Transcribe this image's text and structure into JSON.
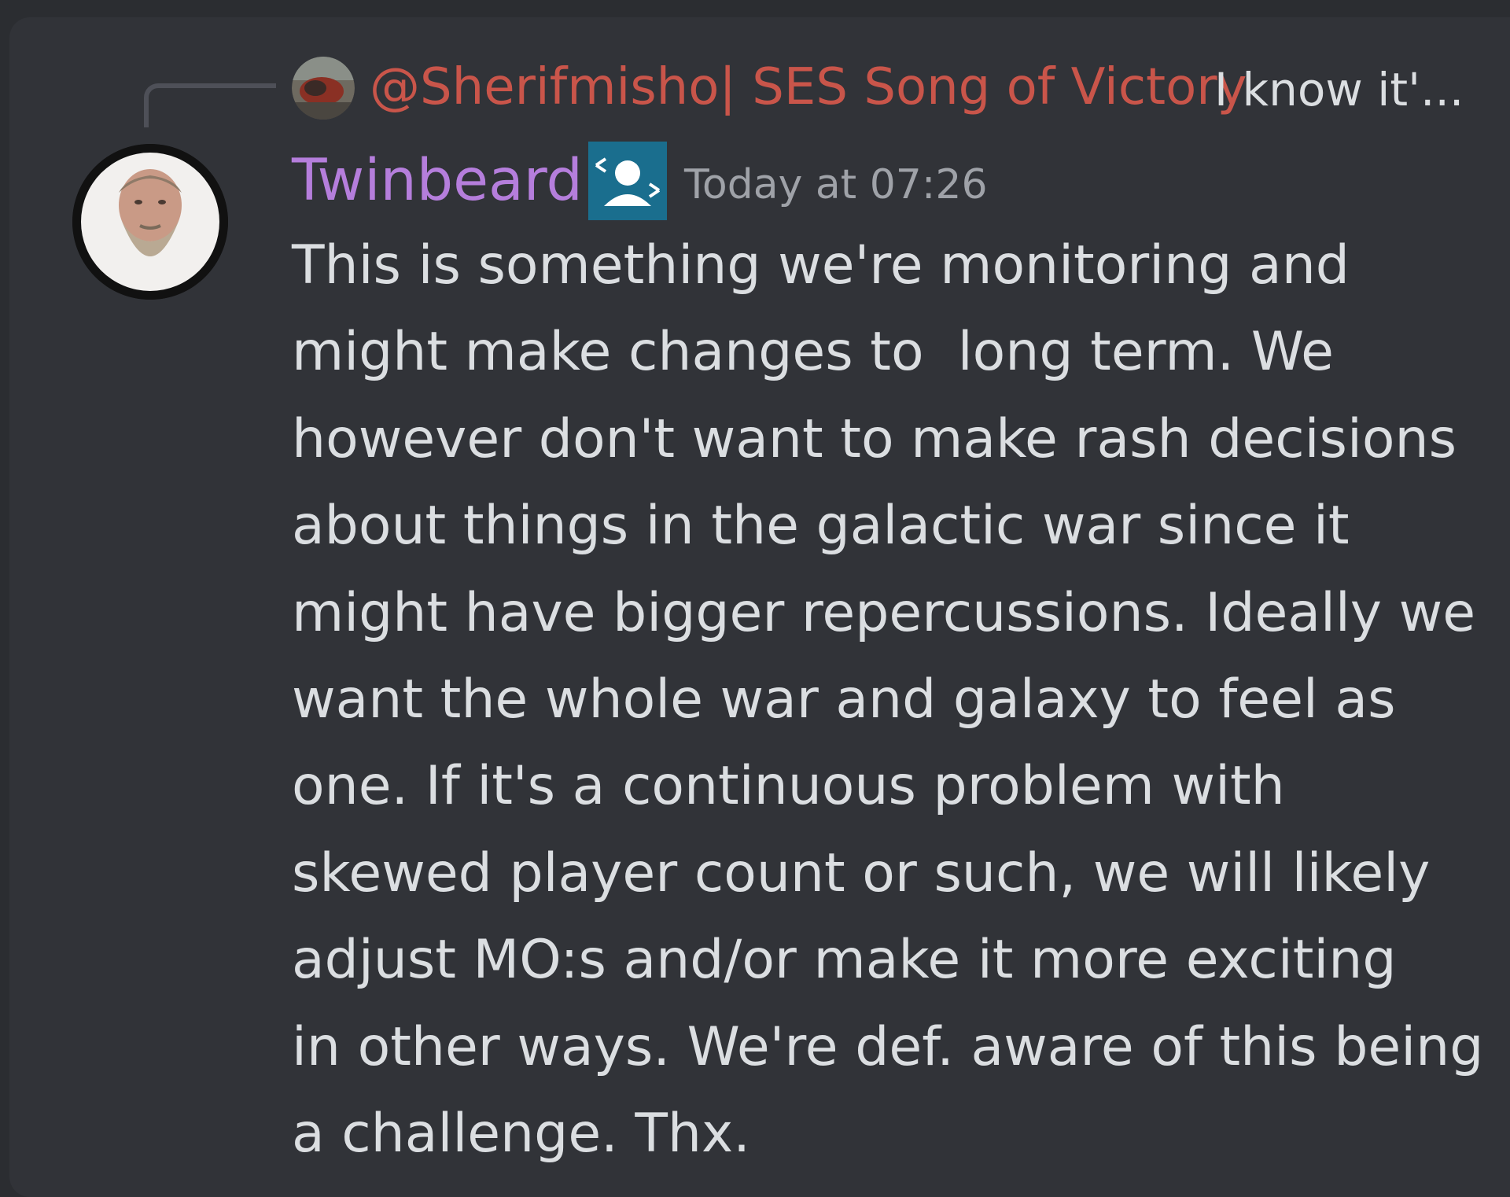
{
  "reply": {
    "author": "@Sherifmisho| SES Song of Victory",
    "snippet": "I know it'..."
  },
  "message": {
    "author": "Twinbeard",
    "timestamp": "Today at 07:26",
    "lines": [
      "This is something we're monitoring and",
      "might make changes to  long term. We",
      "however don't want to make rash decisions",
      "about things in the galactic war since it",
      "might have bigger repercussions. Ideally we",
      "want the whole war and galaxy to feel as",
      "one. If it's a continuous problem with",
      "skewed player count or such, we will likely",
      "adjust MO:s and/or make it more exciting",
      "in other ways. We're def. aware of this being",
      "a challenge. Thx."
    ]
  },
  "colors": {
    "background": "#2b2d31",
    "panel": "#313338",
    "username": "#b57edc",
    "reply_author": "#c9554a",
    "role_badge": "#1a6e8e",
    "text": "#dbdee1",
    "timestamp": "#9fa2a8"
  },
  "icons": {
    "role_badge": "role-badge-icon"
  }
}
